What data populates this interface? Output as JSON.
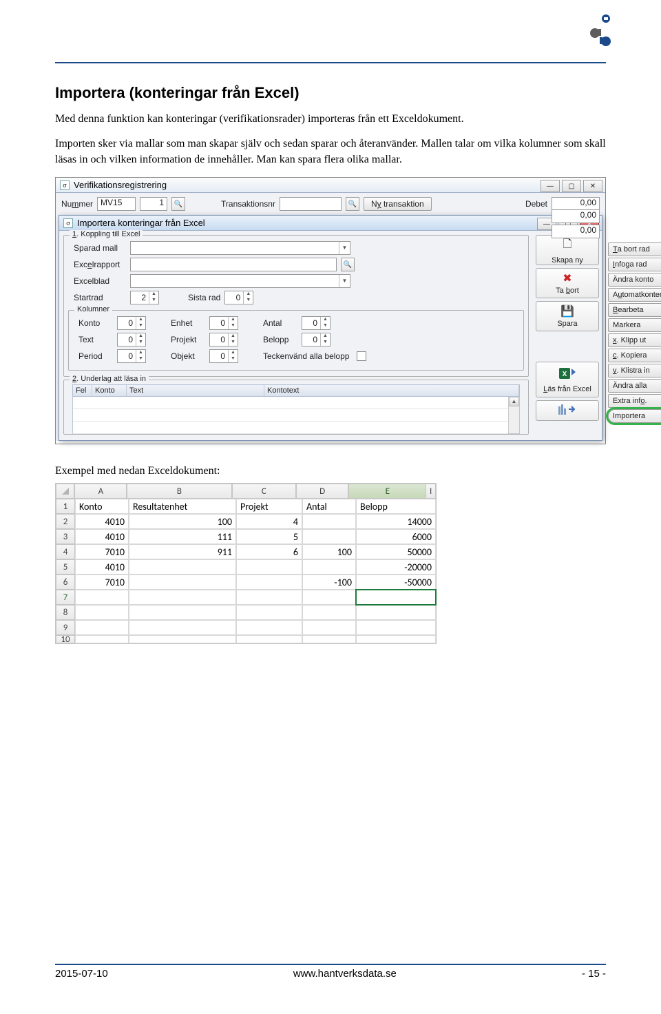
{
  "doc": {
    "heading": "Importera (konteringar från Excel)",
    "para1": "Med denna funktion kan konteringar (verifikationsrader) importeras från ett Exceldokument.",
    "para2": "Importen sker via mallar som man skapar själv och sedan sparar och återanvänder. Mallen talar om vilka kolumner som skall läsas in och vilken information de innehåller. Man kan spara flera olika mallar.",
    "caption_excel": "Exempel med nedan Exceldokument:"
  },
  "footer": {
    "date": "2015-07-10",
    "url": "www.hantverksdata.se",
    "page": "- 15 -"
  },
  "verif": {
    "title": "Verifikationsregistrering",
    "nummer_label": "Nummer",
    "nummer_series": "MV15",
    "nummer_seq": "1",
    "trans_label": "Transaktionsnr",
    "ny_trans_btn": "Ny transaktion",
    "debet_label": "Debet",
    "value_zero": "0,00"
  },
  "import": {
    "title": "Importera konteringar från Excel",
    "legend1": "1. Koppling till Excel",
    "sparad_mall": "Sparad mall",
    "excelrapport": "Excelrapport",
    "excelblad": "Excelblad",
    "startrad": "Startrad",
    "startrad_val": "2",
    "sista_rad": "Sista rad",
    "sista_rad_val": "0",
    "kolumner": "Kolumner",
    "konto": "Konto",
    "konto_val": "0",
    "text": "Text",
    "text_val": "0",
    "period": "Period",
    "period_val": "0",
    "enhet": "Enhet",
    "enhet_val": "0",
    "projekt": "Projekt",
    "projekt_val": "0",
    "objekt": "Objekt",
    "objekt_val": "0",
    "antal": "Antal",
    "antal_val": "0",
    "belopp": "Belopp",
    "belopp_val": "0",
    "teckenvand": "Teckenvänd alla belopp",
    "legend2": "2. Underlag att läsa in",
    "col_fel": "Fel",
    "col_konto": "Konto",
    "col_text": "Text",
    "col_kontotext": "Kontotext",
    "btn_skapa": "Skapa ny",
    "btn_tabort": "Ta bort",
    "btn_spara": "Spara",
    "btn_las": "Läs från Excel"
  },
  "side": {
    "ta_bort_rad": "Ta bort rad",
    "infoga_rad": "Infoga rad",
    "andra_konto": "Ändra konto",
    "automatkontera": "Automatkontera",
    "bearbeta": "Bearbeta",
    "markera": "Markera",
    "klipp": "x. Klipp ut",
    "kopiera": "c. Kopiera",
    "klistra": "v. Klistra in",
    "andra_alla": "Ändra alla",
    "extra": "Extra info.",
    "importera": "Importera"
  },
  "excel": {
    "cols": [
      "A",
      "B",
      "C",
      "D",
      "E"
    ],
    "h": {
      "A": "Konto",
      "B": "Resultatenhet",
      "C": "Projekt",
      "D": "Antal",
      "E": "Belopp"
    },
    "rows": [
      {
        "A": "4010",
        "B": "100",
        "C": "4",
        "D": "",
        "E": "14000"
      },
      {
        "A": "4010",
        "B": "111",
        "C": "5",
        "D": "",
        "E": "6000"
      },
      {
        "A": "7010",
        "B": "911",
        "C": "6",
        "D": "100",
        "E": "50000"
      },
      {
        "A": "4010",
        "B": "",
        "C": "",
        "D": "",
        "E": "-20000"
      },
      {
        "A": "7010",
        "B": "",
        "C": "",
        "D": "-100",
        "E": "-50000"
      }
    ],
    "col_I": "I"
  }
}
